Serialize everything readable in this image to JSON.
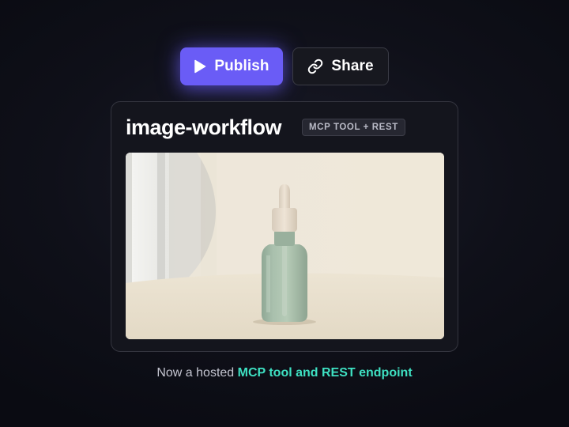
{
  "actions": {
    "publish_label": "Publish",
    "publish_icon": "play-icon",
    "share_label": "Share",
    "share_icon": "link-icon"
  },
  "card": {
    "title": "image-workflow",
    "badge": "MCP TOOL + REST",
    "image_subject": "green glass dropper bottle on a beige backdrop"
  },
  "caption": {
    "prefix": "Now a hosted ",
    "highlight": "MCP tool and REST endpoint"
  },
  "colors": {
    "accent": "#6a5cf6",
    "highlight": "#3ee0c2",
    "background": "#0f1019"
  }
}
